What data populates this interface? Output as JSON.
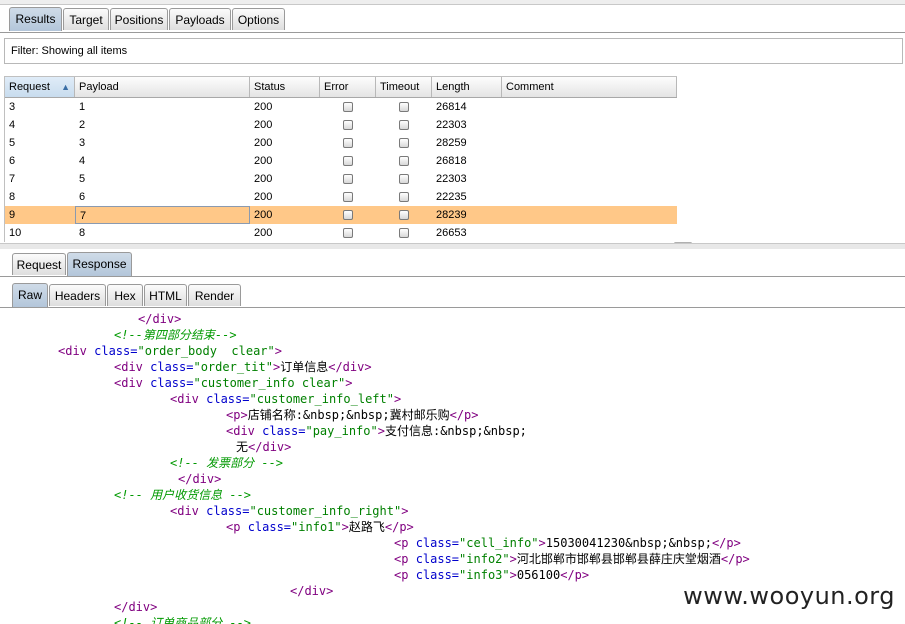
{
  "main_tabs": [
    "Results",
    "Target",
    "Positions",
    "Payloads",
    "Options"
  ],
  "filter": {
    "label": "Filter: Showing all items"
  },
  "table": {
    "columns": [
      "Request",
      "Payload",
      "Status",
      "Error",
      "Timeout",
      "Length",
      "Comment"
    ],
    "sort_arrow": "▲",
    "rows": [
      {
        "request": "3",
        "payload": "1",
        "status": "200",
        "length": "26814"
      },
      {
        "request": "4",
        "payload": "2",
        "status": "200",
        "length": "22303"
      },
      {
        "request": "5",
        "payload": "3",
        "status": "200",
        "length": "28259"
      },
      {
        "request": "6",
        "payload": "4",
        "status": "200",
        "length": "26818"
      },
      {
        "request": "7",
        "payload": "5",
        "status": "200",
        "length": "22303"
      },
      {
        "request": "8",
        "payload": "6",
        "status": "200",
        "length": "22235"
      },
      {
        "request": "9",
        "payload": "7",
        "status": "200",
        "length": "28239"
      },
      {
        "request": "10",
        "payload": "8",
        "status": "200",
        "length": "26653"
      }
    ]
  },
  "req_tabs": [
    "Request",
    "Response"
  ],
  "view_tabs": [
    "Raw",
    "Headers",
    "Hex",
    "HTML",
    "Render"
  ],
  "code": {
    "l1": "</div>",
    "l2": "<!--第四部分结束-->",
    "l3_tag": "<div ",
    "l3_attr": "class=",
    "l3_val": "\"order_body  clear\"",
    "l3_end": ">",
    "l4_tag": "<div ",
    "l4_attr": "class=",
    "l4_val": "\"order_tit\"",
    "l4_end": ">",
    "l4_txt": "订单信息",
    "l4_close": "</div>",
    "l5_tag": "<div ",
    "l5_attr": "class=",
    "l5_val": "\"customer_info clear\"",
    "l5_end": ">",
    "l6_tag": "<div ",
    "l6_attr": "class=",
    "l6_val": "\"customer_info_left\"",
    "l6_end": ">",
    "l7_tag": "<p>",
    "l7_txt": "店铺名称:&nbsp;&nbsp;冀村邮乐购",
    "l7_close": "</p>",
    "l8_tag": "<div ",
    "l8_attr": "class=",
    "l8_val": "\"pay_info\"",
    "l8_end": ">",
    "l8_txt": "支付信息:&nbsp;&nbsp;",
    "l9_txt": "无",
    "l9_close": "</div>",
    "l10": "<!-- 发票部分 -->",
    "l11": "</div>",
    "l12": "<!-- 用户收货信息 -->",
    "l13_tag": "<div ",
    "l13_attr": "class=",
    "l13_val": "\"customer_info_right\"",
    "l13_end": ">",
    "l14_tag": "<p ",
    "l14_attr": "class=",
    "l14_val": "\"info1\"",
    "l14_end": ">",
    "l14_txt": "赵路飞",
    "l14_close": "</p>",
    "l15_tag": "<p ",
    "l15_attr": "class=",
    "l15_val": "\"cell_info\"",
    "l15_end": ">",
    "l15_txt": "15030041230&nbsp;&nbsp;",
    "l15_close": "</p>",
    "l16_tag": "<p ",
    "l16_attr": "class=",
    "l16_val": "\"info2\"",
    "l16_end": ">",
    "l16_txt": "河北邯郸市邯郸县邯郸县薛庄庆堂烟酒",
    "l16_close": "</p>",
    "l17_tag": "<p ",
    "l17_attr": "class=",
    "l17_val": "\"info3\"",
    "l17_end": ">",
    "l17_txt": "056100",
    "l17_close": "</p>",
    "l18": "</div>",
    "l19": "</div>",
    "l20": "<!-- 订单商品部分 -->"
  },
  "watermark": "www.wooyun.org"
}
